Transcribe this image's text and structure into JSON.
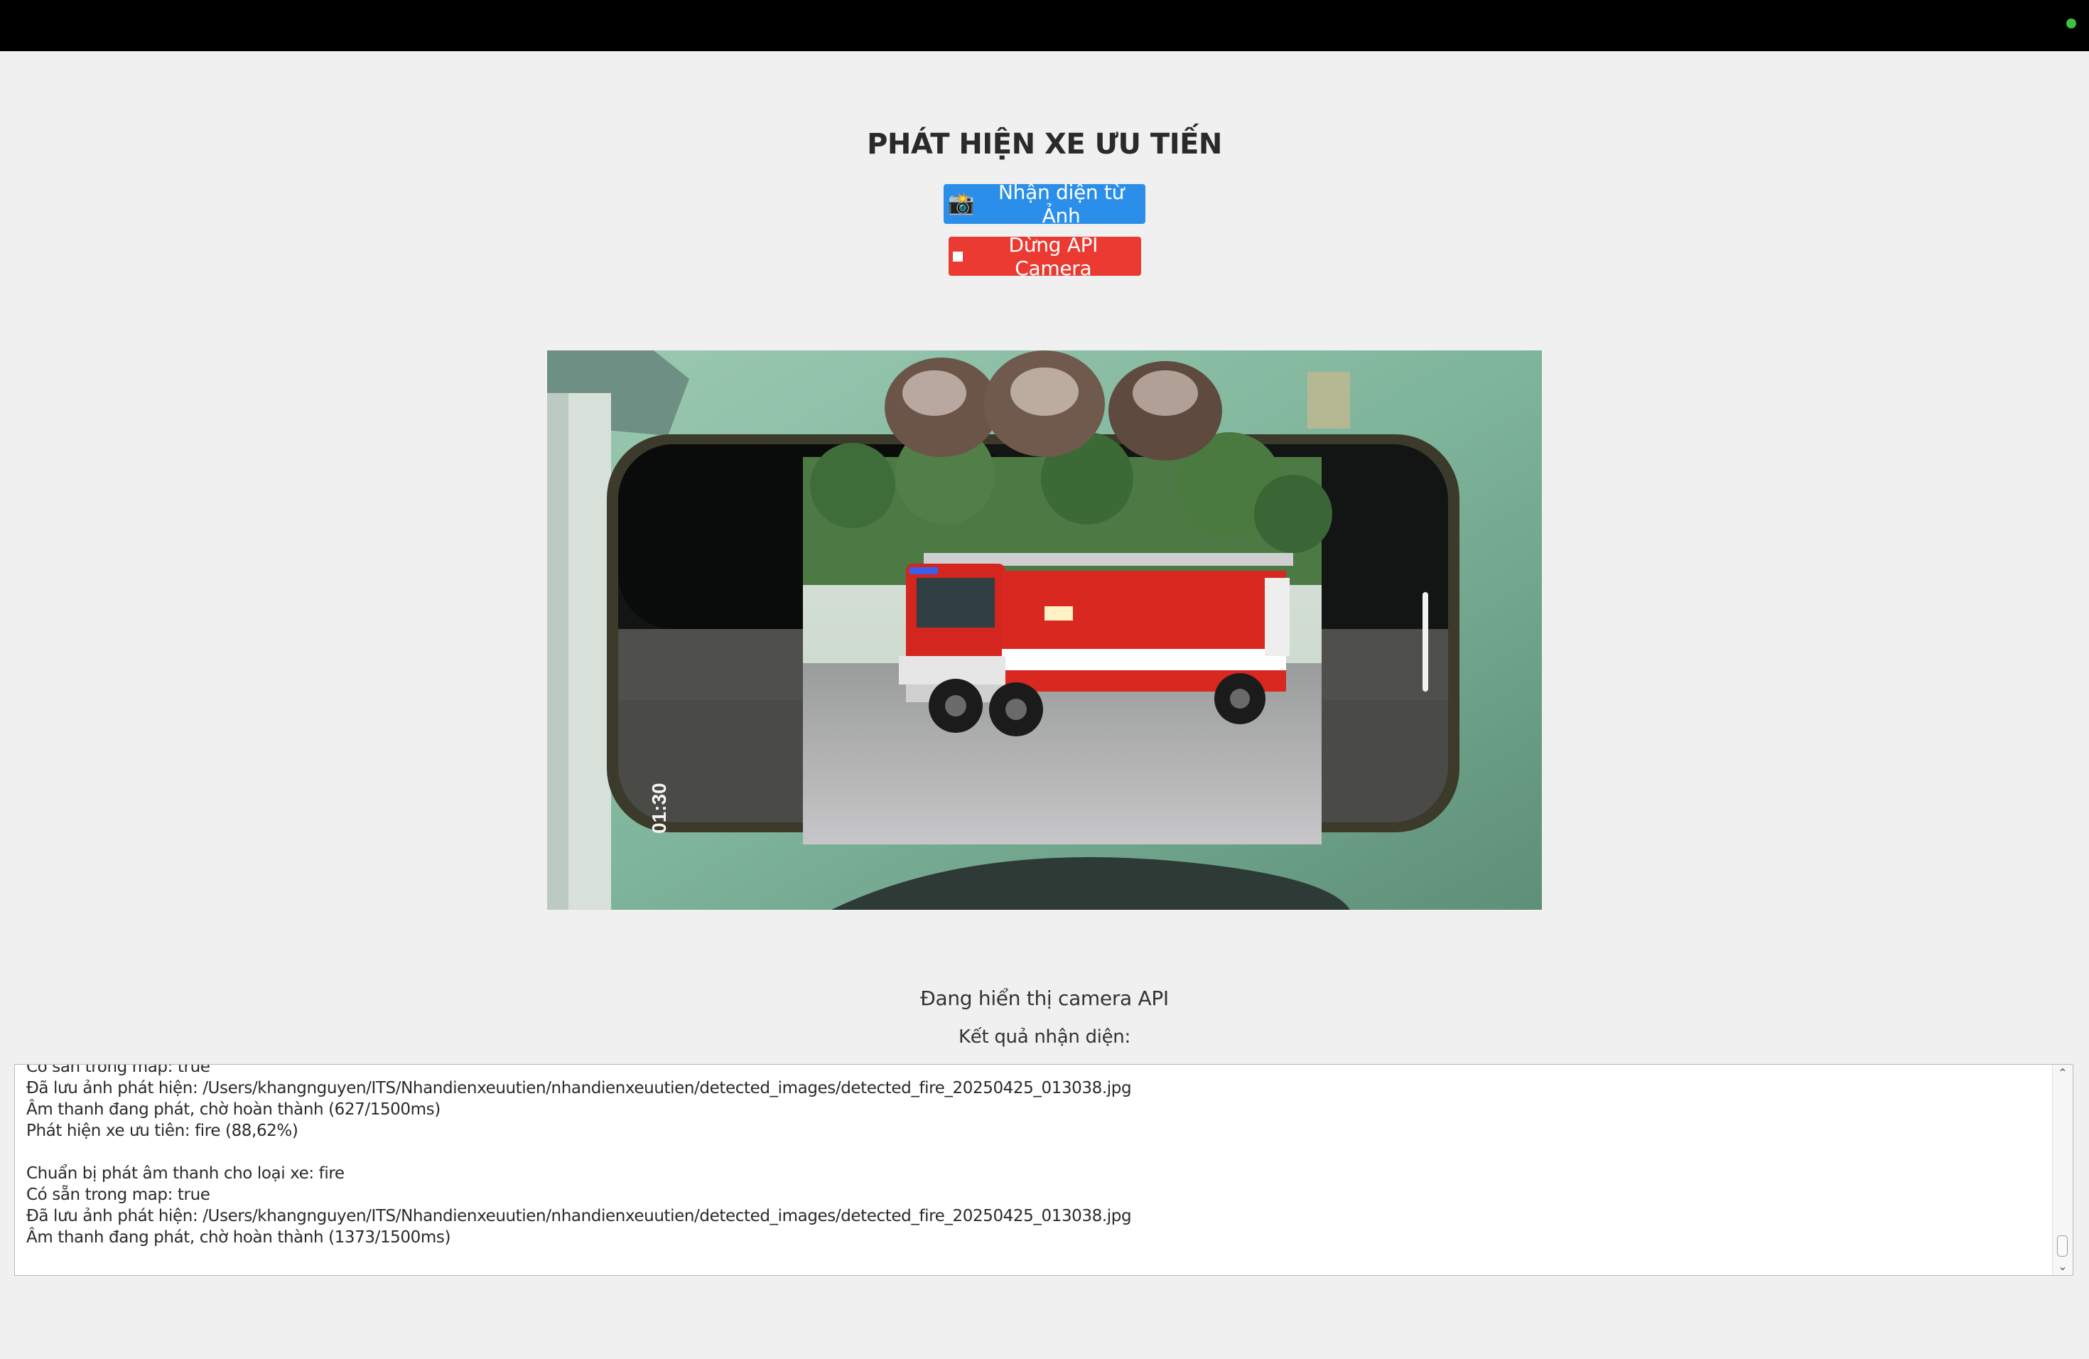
{
  "app": {
    "title": "PHÁT HIỆN XE ƯU TIẾN"
  },
  "buttons": {
    "detect_image": {
      "icon": "camera-icon",
      "icon_glyph": "📸",
      "label": "Nhận diện từ Ảnh",
      "color": "#2b8fea"
    },
    "stop_camera": {
      "icon": "stop-icon",
      "label": "Dừng API Camera",
      "color": "#ea3a31"
    }
  },
  "camera": {
    "description": "fire truck shown on a phone screen",
    "phone_time": "01:30"
  },
  "status": {
    "text": "Đang hiển thị camera API"
  },
  "results": {
    "label": "Kết quả nhận diện:",
    "log": [
      "Có sẵn trong map: true",
      "Đã lưu ảnh phát hiện: /Users/khangnguyen/ITS/Nhandienxeuutien/nhandienxeuutien/detected_images/detected_fire_20250425_013038.jpg",
      "Âm thanh đang phát, chờ hoàn thành (627/1500ms)",
      "Phát hiện xe ưu tiên: fire (88,62%)",
      "",
      "Chuẩn bị phát âm thanh cho loại xe: fire",
      "Có sẵn trong map: true",
      "Đã lưu ảnh phát hiện: /Users/khangnguyen/ITS/Nhandienxeuutien/nhandienxeuutien/detected_images/detected_fire_20250425_013038.jpg",
      "Âm thanh đang phát, chờ hoàn thành (1373/1500ms)"
    ]
  },
  "colors": {
    "background": "#f0f0f0",
    "topbar": "#000000",
    "status_dot": "#3ec13e"
  }
}
